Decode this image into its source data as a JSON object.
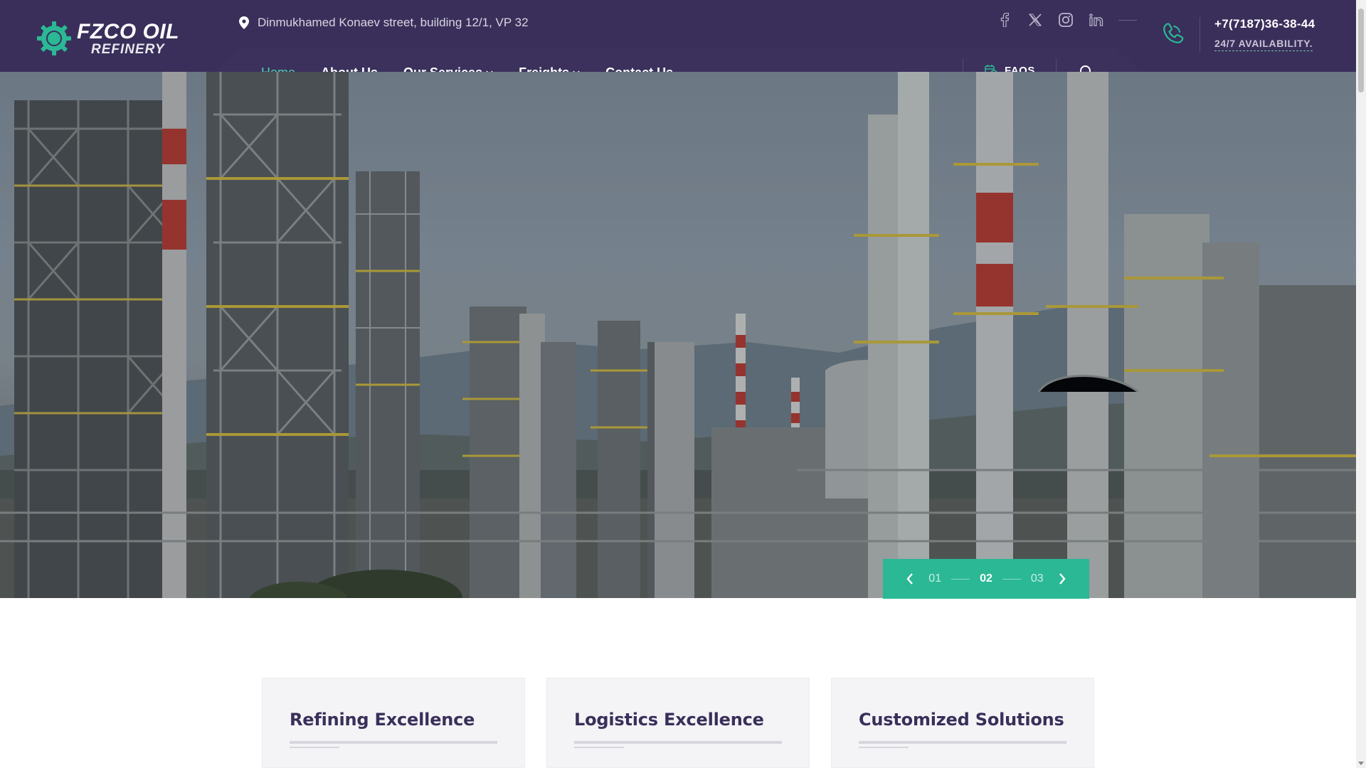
{
  "header": {
    "logo": {
      "line1": "FZCO OIL",
      "line2": "REFINERY",
      "badge": "FZCO"
    },
    "address": "Dinmukhamed Konaev street, building 12/1, VP 32",
    "socials": [
      {
        "name": "facebook-icon"
      },
      {
        "name": "x-twitter-icon"
      },
      {
        "name": "instagram-icon"
      },
      {
        "name": "linkedin-icon"
      }
    ],
    "phone": "+7(7187)36-38-44",
    "availability": "24/7 AVAILABILITY."
  },
  "nav": {
    "items": [
      {
        "label": "Home",
        "active": true
      },
      {
        "label": "About Us"
      },
      {
        "label": "Our Services",
        "dropdown": true
      },
      {
        "label": "Freights",
        "dropdown": true
      },
      {
        "label": "Contact Us"
      }
    ],
    "faqs_label": "FAQS"
  },
  "slider": {
    "slides": [
      "01",
      "02",
      "03"
    ],
    "active": "02"
  },
  "cards": [
    {
      "title": "Refining Excellence"
    },
    {
      "title": "Logistics Excellence"
    },
    {
      "title": "Customized Solutions"
    }
  ],
  "colors": {
    "header_bg": "#3a2f5a",
    "accent": "#2bb895",
    "accent_text": "#4fd1ad",
    "card_title": "#3a2f5a"
  }
}
